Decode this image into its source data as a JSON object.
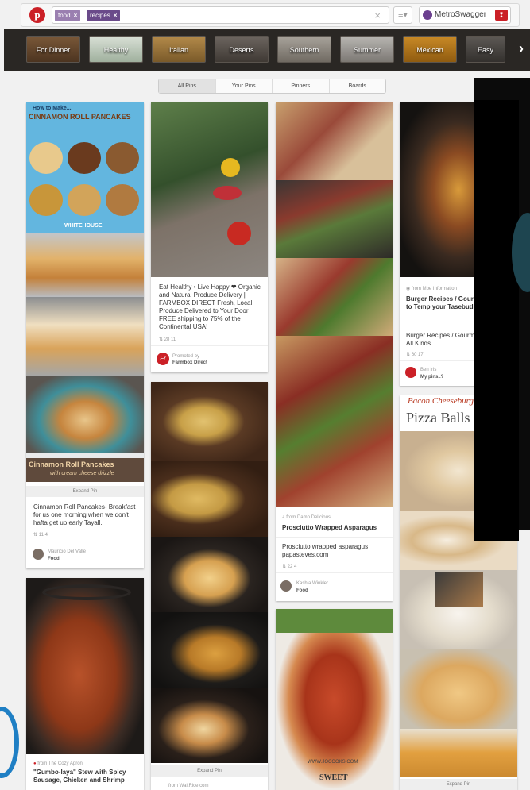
{
  "topbar": {
    "logo": "p",
    "chips": [
      "food",
      "recipes"
    ],
    "user": "MetroSwagger"
  },
  "categories": [
    "For Dinner",
    "Healthy",
    "Italian",
    "Deserts",
    "Southern",
    "Summer",
    "Mexican",
    "Easy"
  ],
  "tabs": [
    "All Pins",
    "Your Pins",
    "Pinners",
    "Boards"
  ],
  "pins": {
    "cinnamon": {
      "title_top": "How to Make...",
      "title_main": "CINNAMON ROLL PANCAKES",
      "site": "WHITEHOUSE",
      "banner": "Cinnamon Roll Pancakes",
      "banner_sub": "with cream cheese drizzle",
      "expand": "Expand Pin",
      "desc": "Cinnamon Roll Pancakes- Breakfast for us one morning when we don't hafta get up early Tayall.",
      "stats": "11  4",
      "pinner": "Mauricio Del Valle",
      "board": "Food"
    },
    "farmbox": {
      "desc": "Eat Healthy • Live Happy ❤ Organic and Natural Produce Delivery | FARMBOX DIRECT Fresh, Local Produce Delivered to Your Door FREE shipping to 75% of the Continental USA!",
      "stats": "28  11",
      "promoted": "Promoted by",
      "promoter": "Farmbox Direct"
    },
    "burger": {
      "source": "from Mbe Information",
      "title": "Burger Recipes / Gourmet Burgers to Temp your Tasebuds",
      "desc": "Burger Recipes / Gourmet Burgers of All Kinds",
      "stats": "60  17",
      "pinner": "Ben Iris",
      "board": "My pins..?"
    },
    "pizza": {
      "line1": "Bacon Cheeseburger",
      "line2": "Pizza Balls",
      "expand": "Expand Pin"
    },
    "asparagus": {
      "source": "from Damn Delicious",
      "title": "Prosciutto Wrapped Asparagus",
      "desc": "Prosciutto wrapped asparagus papasteves.com",
      "stats": "22  4",
      "pinner": "Kashia Winkler",
      "board": "Food"
    },
    "potato": {
      "expand": "Expand Pin",
      "source": "from WaltRice.com"
    },
    "gumbo": {
      "source": "from The Cozy Apron",
      "title": "\"Gumbo-laya\" Stew with Spicy Sausage, Chicken and Shrimp"
    },
    "chicken": {
      "site": "WWW.JOCOOKS.COM",
      "label": "SWEET"
    }
  }
}
